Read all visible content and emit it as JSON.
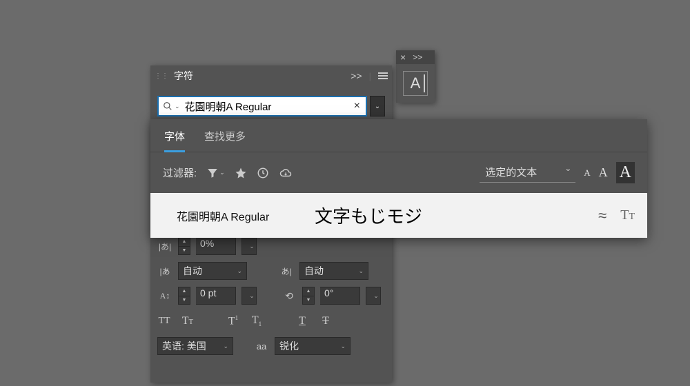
{
  "char_panel": {
    "title": "字符",
    "collapse_label": ">>"
  },
  "search": {
    "value": "花園明朝A Regular",
    "placeholder": ""
  },
  "dropdown": {
    "tabs": {
      "fonts": "字体",
      "more": "查找更多"
    },
    "filter_label": "过滤器:",
    "selected_text_label": "选定的文本",
    "font_item": {
      "name": "花園明朝A Regular",
      "sample": "文字もじモジ",
      "approx": "≈"
    }
  },
  "ctrls": {
    "tsume": "0%",
    "kerning": "自动",
    "tracking": "自动",
    "baseline": "0 pt",
    "rotation": "0°",
    "language": "英语: 美国",
    "aa_icon": "aa",
    "aa": "锐化"
  },
  "glyphs": {
    "A": "A",
    "small_a": "A"
  },
  "icon_panel": {
    "close": "×",
    "collapse": ">>",
    "letter": "A"
  }
}
